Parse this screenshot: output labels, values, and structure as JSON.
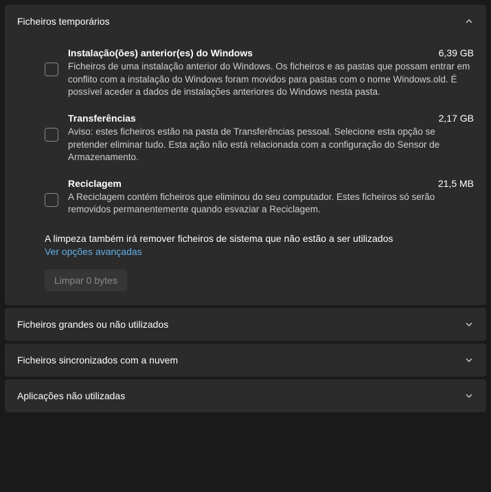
{
  "sections": {
    "temp": {
      "title": "Ficheiros temporários"
    },
    "large": {
      "title": "Ficheiros grandes ou não utilizados"
    },
    "cloud": {
      "title": "Ficheiros sincronizados com a nuvem"
    },
    "apps": {
      "title": "Aplicações não utilizadas"
    }
  },
  "temp_items": [
    {
      "title": "Instalação(ões) anterior(es) do Windows",
      "size": "6,39 GB",
      "desc": "Ficheiros de uma instalação anterior do Windows. Os ficheiros e as pastas que possam entrar em conflito com a instalação do Windows foram movidos para pastas com o nome Windows.old. É possível aceder a dados de instalações anteriores do Windows nesta pasta."
    },
    {
      "title": "Transferências",
      "size": "2,17 GB",
      "desc": "Aviso: estes ficheiros estão na pasta de Transferências pessoal. Selecione esta opção se pretender eliminar tudo. Esta ação não está relacionada com a configuração do Sensor de Armazenamento."
    },
    {
      "title": "Reciclagem",
      "size": "21,5 MB",
      "desc": "A Reciclagem contém ficheiros que eliminou do seu computador. Estes ficheiros só serão removidos permanentemente quando esvaziar a Reciclagem."
    }
  ],
  "footer": {
    "note": "A limpeza também irá remover ficheiros de sistema que não estão a ser utilizados",
    "advanced_link": "Ver opções avançadas",
    "clean_button": "Limpar 0 bytes"
  }
}
